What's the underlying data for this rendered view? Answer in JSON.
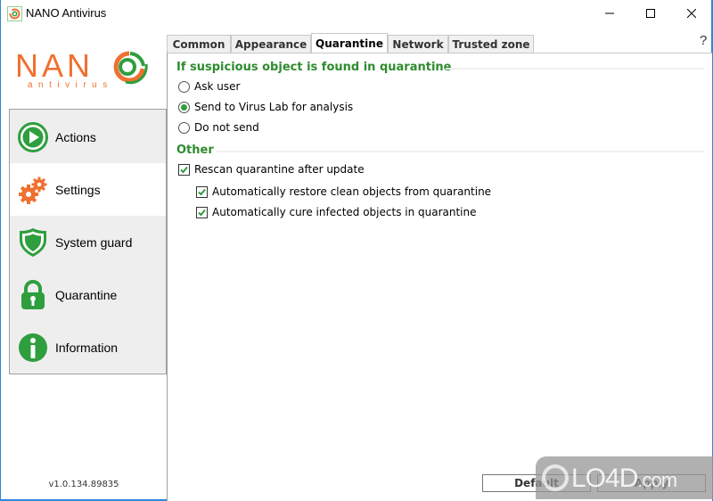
{
  "window": {
    "title": "NANO Antivirus",
    "controls": {
      "minimize": "–",
      "maximize": "☐",
      "close": "✕"
    },
    "border_color": "#2b88d8"
  },
  "logo": {
    "word": "NAN",
    "o_letter": "O",
    "sub": "antivirus",
    "orange": "#f07030",
    "green": "#2e9e3e"
  },
  "sidebar": {
    "items": [
      {
        "label": "Actions",
        "icon": "play-circle-icon",
        "active": false
      },
      {
        "label": "Settings",
        "icon": "gears-icon",
        "active": true
      },
      {
        "label": "System guard",
        "icon": "shield-icon",
        "active": false
      },
      {
        "label": "Quarantine",
        "icon": "padlock-icon",
        "active": false
      },
      {
        "label": "Information",
        "icon": "info-icon",
        "active": false
      }
    ],
    "version": "v1.0.134.89835"
  },
  "tabs": [
    {
      "label": "Common",
      "active": false
    },
    {
      "label": "Appearance",
      "active": false
    },
    {
      "label": "Quarantine",
      "active": true
    },
    {
      "label": "Network",
      "active": false
    },
    {
      "label": "Trusted zone",
      "active": false
    }
  ],
  "help_label": "?",
  "content": {
    "section1": {
      "title": "If suspicious object is found in quarantine",
      "options": [
        {
          "label": "Ask user",
          "selected": false
        },
        {
          "label": "Send to Virus Lab for analysis",
          "selected": true
        },
        {
          "label": "Do not send",
          "selected": false
        }
      ]
    },
    "section2": {
      "title": "Other",
      "checks": [
        {
          "label": "Rescan quarantine after update",
          "checked": true
        },
        {
          "label": "Automatically restore clean objects from quarantine",
          "checked": true
        },
        {
          "label": "Automatically cure infected objects in quarantine",
          "checked": true
        }
      ]
    }
  },
  "buttons": {
    "default": "Default",
    "apply": "Apply"
  },
  "watermark": {
    "text": "LO4D",
    "suffix": ".com"
  },
  "colors": {
    "accent_green": "#2e8b2e",
    "icon_green": "#2e9e3e",
    "icon_orange": "#f07030"
  }
}
